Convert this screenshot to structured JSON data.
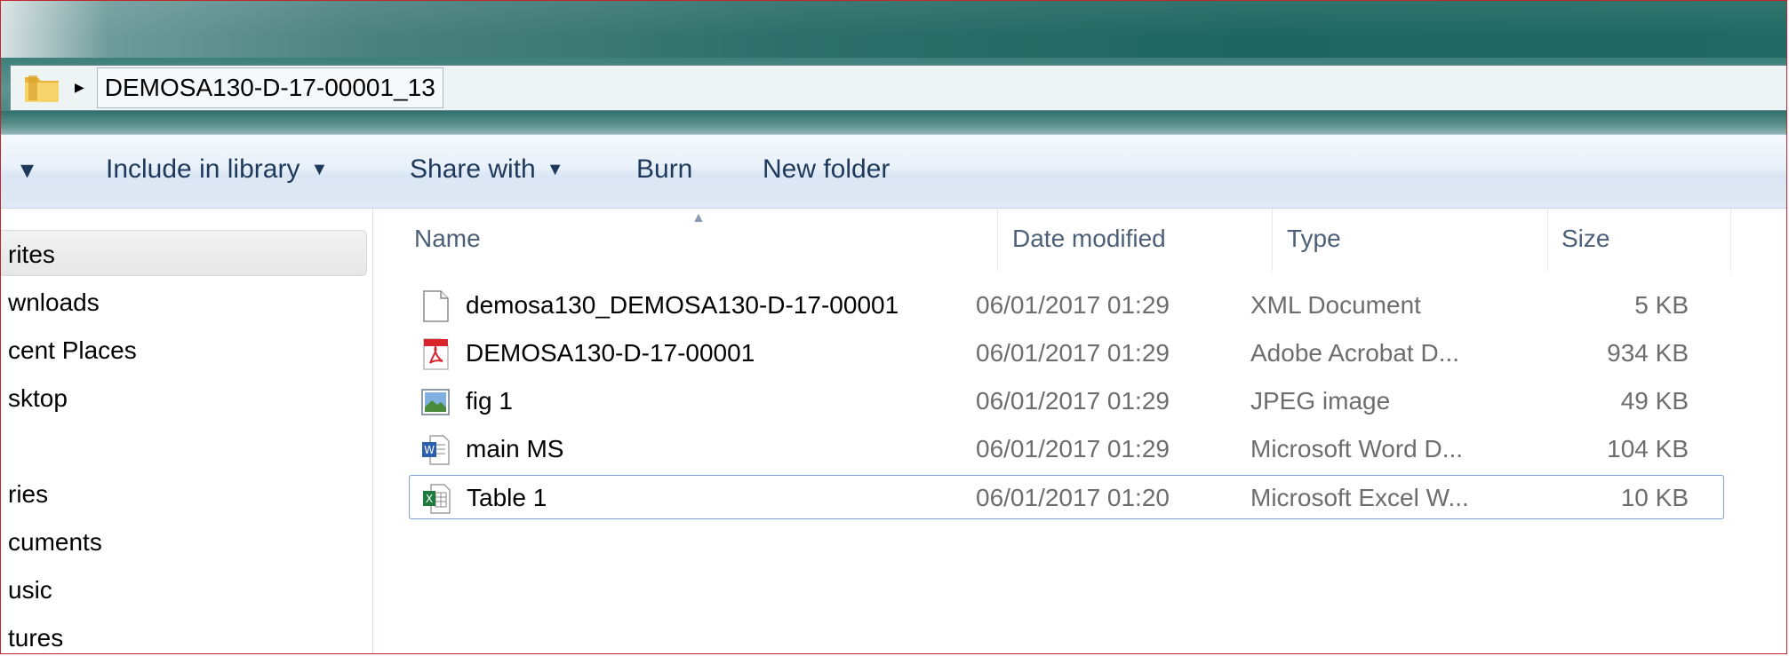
{
  "address": {
    "crumb": "DEMOSA130-D-17-00001_13"
  },
  "toolbar": {
    "organize_arrow": "▾",
    "include_in_library": "Include in library",
    "share_with": "Share with",
    "burn": "Burn",
    "new_folder": "New folder"
  },
  "nav": {
    "items": [
      {
        "label": "rites",
        "selected": true
      },
      {
        "label": "wnloads"
      },
      {
        "label": "cent Places"
      },
      {
        "label": "sktop"
      },
      {
        "label": "ries"
      },
      {
        "label": "cuments"
      },
      {
        "label": "usic"
      },
      {
        "label": "tures"
      }
    ]
  },
  "columns": {
    "name": "Name",
    "date": "Date modified",
    "type": "Type",
    "size": "Size"
  },
  "files": [
    {
      "name": "demosa130_DEMOSA130-D-17-00001",
      "date": "06/01/2017 01:29",
      "type": "XML Document",
      "size": "5 KB",
      "icon": "xml-file-icon"
    },
    {
      "name": "DEMOSA130-D-17-00001",
      "date": "06/01/2017 01:29",
      "type": "Adobe Acrobat D...",
      "size": "934 KB",
      "icon": "pdf-file-icon"
    },
    {
      "name": "fig 1",
      "date": "06/01/2017 01:29",
      "type": "JPEG image",
      "size": "49 KB",
      "icon": "image-file-icon"
    },
    {
      "name": "main MS",
      "date": "06/01/2017 01:29",
      "type": "Microsoft Word D...",
      "size": "104 KB",
      "icon": "word-file-icon"
    },
    {
      "name": "Table 1",
      "date": "06/01/2017 01:20",
      "type": "Microsoft Excel W...",
      "size": "10 KB",
      "icon": "excel-file-icon",
      "focused": true
    }
  ],
  "colors": {
    "aero": "#2d6e69",
    "text_link": "#1e395b",
    "focus_border": "#7da2ce"
  }
}
